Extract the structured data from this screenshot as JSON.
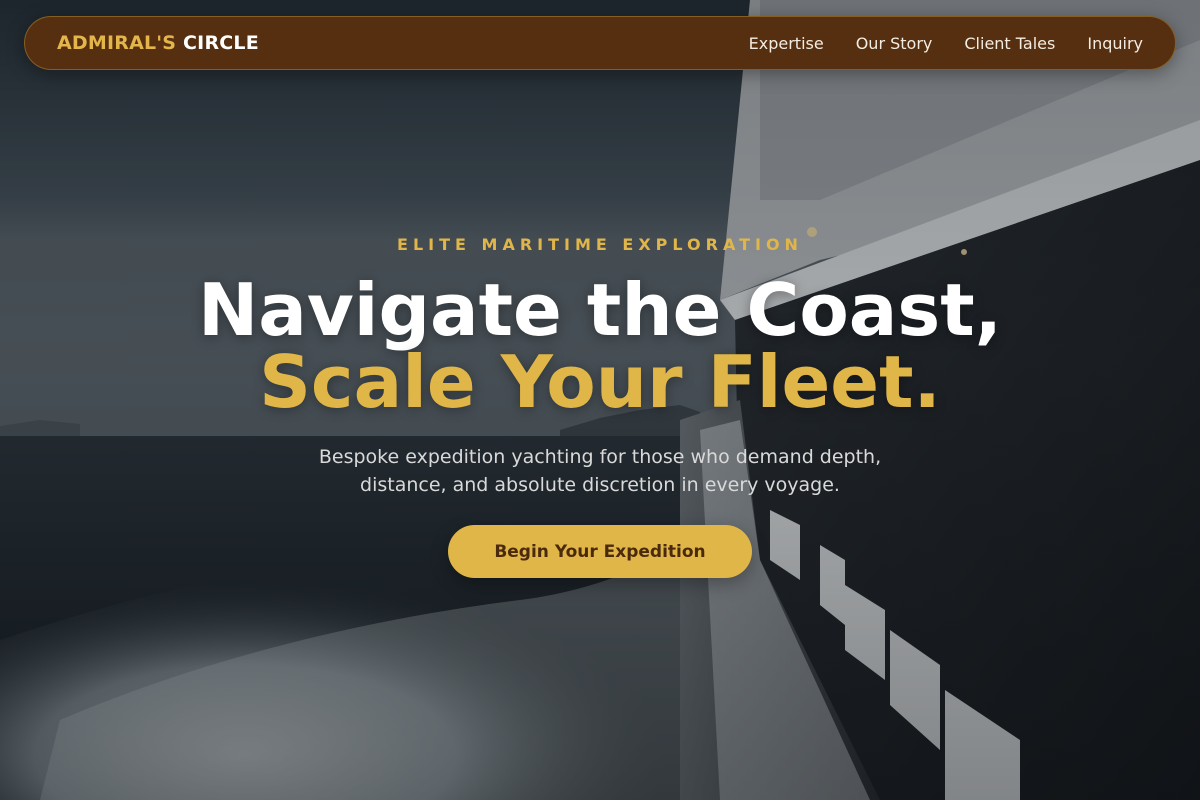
{
  "nav": {
    "brand_accent": "ADMIRAL'S",
    "brand_rest": "CIRCLE",
    "links": [
      "Expertise",
      "Our Story",
      "Client Tales",
      "Inquiry"
    ]
  },
  "hero": {
    "eyebrow": "ELITE MARITIME EXPLORATION",
    "headline_line1": "Navigate the Coast,",
    "headline_line2": "Scale Your Fleet.",
    "subtitle": "Bespoke expedition yachting for those who demand depth, distance, and absolute discretion in every voyage.",
    "cta_label": "Begin Your Expedition"
  },
  "colors": {
    "nav_bg": "#552f10",
    "accent_gold": "#e1b648",
    "cta_text": "#4a2a0d"
  },
  "background": {
    "description_icon": "yacht-sea-photo"
  }
}
